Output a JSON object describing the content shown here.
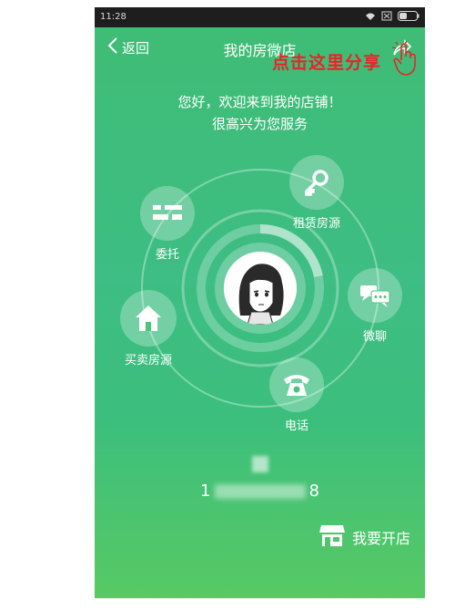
{
  "status_bar": {
    "time": "11:28",
    "icons": [
      "wifi-icon",
      "sim-icon",
      "battery-icon"
    ]
  },
  "nav": {
    "back_label": "返回",
    "title": "我的房微店",
    "share_icon": "share-icon"
  },
  "annotation": {
    "share_hint": "点击这里分享"
  },
  "greeting": {
    "line1": "您好，欢迎来到我的店铺！",
    "line2": "很高兴为您服务"
  },
  "menu": {
    "entrust": {
      "label": "委托",
      "icon": "entrust-icon"
    },
    "rent": {
      "label": "租赁房源",
      "icon": "key-icon"
    },
    "chat": {
      "label": "微聊",
      "icon": "chat-icon"
    },
    "buy_sell": {
      "label": "买卖房源",
      "icon": "house-icon"
    },
    "phone": {
      "label": "电话",
      "icon": "phone-icon"
    }
  },
  "owner": {
    "name_visible": "",
    "phone_prefix": "1",
    "phone_suffix": "8"
  },
  "open_shop": {
    "label": "我要开店",
    "icon": "shop-icon"
  },
  "colors": {
    "background_top": "#3fbd74",
    "background_bottom": "#58c964",
    "hint_red": "#e8242a"
  }
}
